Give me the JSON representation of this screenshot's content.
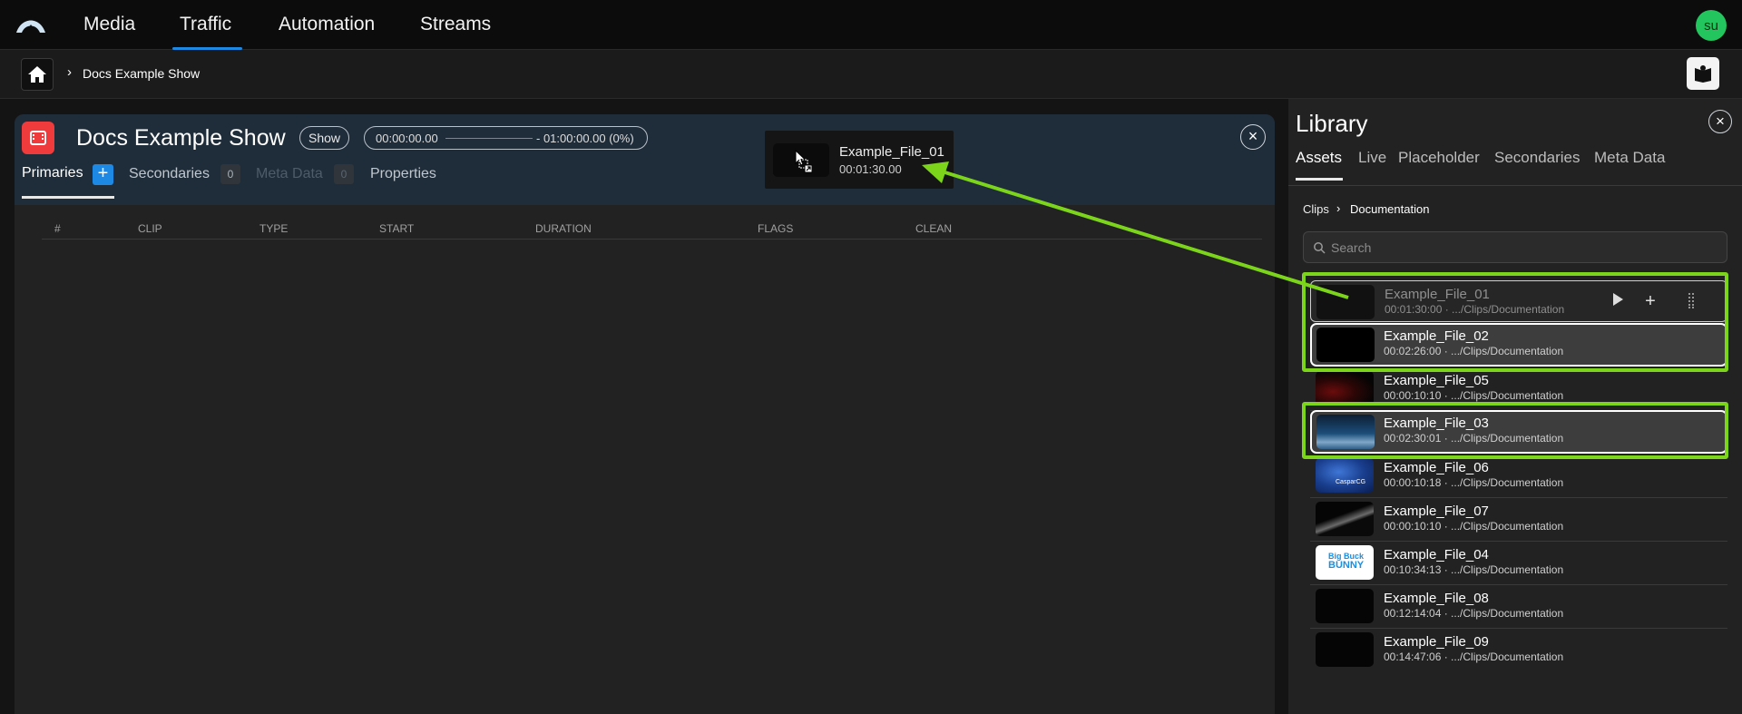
{
  "nav": {
    "items": [
      "Media",
      "Traffic",
      "Automation",
      "Streams"
    ],
    "active": "Traffic",
    "user_initials": "su"
  },
  "breadcrumb": {
    "current": "Docs Example Show"
  },
  "show": {
    "title": "Docs Example Show",
    "badge": "Show",
    "time_start": "00:00:00.00",
    "time_end": "- 01:00:00.00 (0%)",
    "tabs": {
      "primaries": "Primaries",
      "secondaries": "Secondaries",
      "secondaries_count": "0",
      "meta": "Meta Data",
      "meta_count": "0",
      "properties": "Properties"
    },
    "columns": [
      "#",
      "CLIP",
      "TYPE",
      "START",
      "DURATION",
      "FLAGS",
      "CLEAN"
    ]
  },
  "drag_ghost": {
    "name": "Example_File_01",
    "duration": "00:01:30.00"
  },
  "library": {
    "title": "Library",
    "tabs": [
      "Assets",
      "Live",
      "Placeholder",
      "Secondaries",
      "Meta Data"
    ],
    "active_tab": "Assets",
    "crumb_root": "Clips",
    "crumb_folder": "Documentation",
    "search_placeholder": "Search",
    "clips": [
      {
        "name": "Example_File_01",
        "meta": "00:01:30:00 · .../Clips/Documentation"
      },
      {
        "name": "Example_File_02",
        "meta": "00:02:26:00 · .../Clips/Documentation"
      },
      {
        "name": "Example_File_05",
        "meta": "00:00:10:10 · .../Clips/Documentation"
      },
      {
        "name": "Example_File_03",
        "meta": "00:02:30:01 · .../Clips/Documentation"
      },
      {
        "name": "Example_File_06",
        "meta": "00:00:10:18 · .../Clips/Documentation"
      },
      {
        "name": "Example_File_07",
        "meta": "00:00:10:10 · .../Clips/Documentation"
      },
      {
        "name": "Example_File_04",
        "meta": "00:10:34:13 · .../Clips/Documentation"
      },
      {
        "name": "Example_File_08",
        "meta": "00:12:14:04 · .../Clips/Documentation"
      },
      {
        "name": "Example_File_09",
        "meta": "00:14:47:06 · .../Clips/Documentation"
      }
    ],
    "thumb_text": {
      "file_06": "CasparCG",
      "file_04_line1": "Big Buck",
      "file_04_line2": "BUNNY"
    }
  },
  "colors": {
    "accent": "#1e88e5",
    "highlight": "#7cd51a",
    "show_icon": "#ef3b3b",
    "avatar": "#22c55e"
  }
}
